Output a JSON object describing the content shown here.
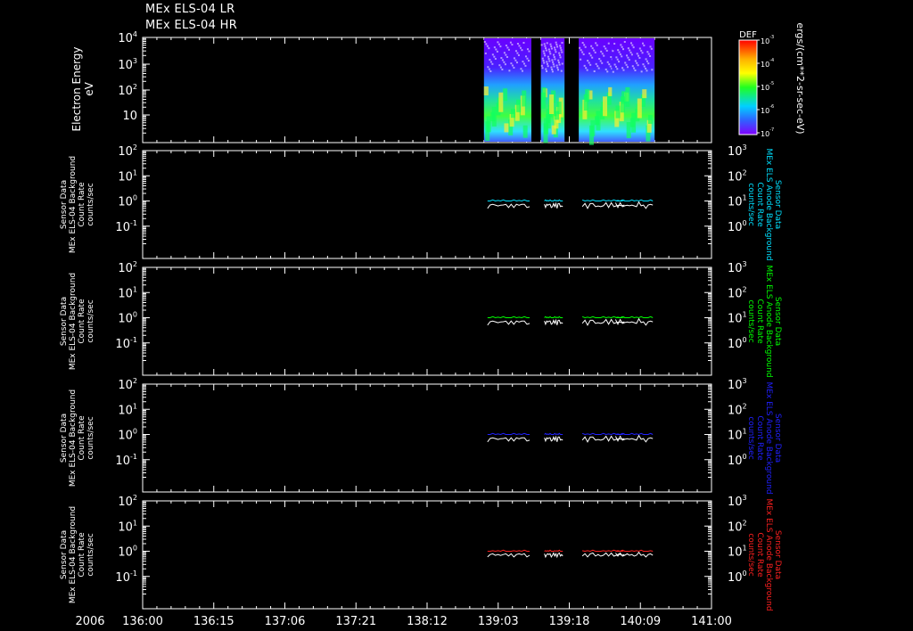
{
  "titles": [
    "MEx ELS-04 LR",
    "MEx ELS-04 HR"
  ],
  "year": "2006",
  "x_ticks": [
    "136:00",
    "136:15",
    "137:06",
    "137:21",
    "138:12",
    "139:03",
    "139:18",
    "140:09",
    "141:00"
  ],
  "colorbar": {
    "title": "DEF",
    "label": "ergs/(cm**2-sr-sec-eV)",
    "tick_labels": [
      {
        "m": "10",
        "e": "-3"
      },
      {
        "m": "10",
        "e": "-4"
      },
      {
        "m": "10",
        "e": "-5"
      },
      {
        "m": "10",
        "e": "-6"
      },
      {
        "m": "10",
        "e": "-7"
      }
    ]
  },
  "chart_data": [
    {
      "type": "heatmap",
      "ylabel": [
        "Electron Energy",
        "eV"
      ],
      "y_scale": "log",
      "y_ticks": [
        {
          "m": "10",
          "e": "4"
        },
        {
          "m": "10",
          "e": "3"
        },
        {
          "m": "10",
          "e": "2"
        },
        {
          "m": "10",
          "e": ""
        }
      ],
      "data_intervals": [
        [
          "139:00",
          "139:10"
        ],
        [
          "139:12",
          "139:17"
        ],
        [
          "139:20",
          "139:30"
        ],
        [
          "140:03",
          "140:12"
        ]
      ],
      "colors": {
        "low": "#5f00ff",
        "high": "#ff0000"
      }
    },
    {
      "type": "line",
      "ylabel_left": [
        "Sensor Data",
        "MEx ELS-04 Background",
        "Count Rate",
        "counts/sec"
      ],
      "ylabel_right": [
        "Sensor Data",
        "MEx ELS Anode Background",
        "Count Rate",
        "counts/sec"
      ],
      "right_color": "#00e0ff",
      "y_scale": "log",
      "left_ticks": [
        {
          "m": "10",
          "e": "2"
        },
        {
          "m": "10",
          "e": "1"
        },
        {
          "m": "10",
          "e": "0"
        },
        {
          "m": "10",
          "e": "-1"
        }
      ],
      "right_ticks": [
        {
          "m": "10",
          "e": "3"
        },
        {
          "m": "10",
          "e": "2"
        },
        {
          "m": "10",
          "e": "1"
        },
        {
          "m": "10",
          "e": "0"
        }
      ],
      "series": [
        {
          "color": "#ffffff",
          "values": [
            0.6,
            0.7,
            0.65,
            0.75,
            0.6,
            0.8,
            0.7,
            0.65
          ]
        },
        {
          "color": "#00e0ff",
          "values": [
            1.0,
            1.0,
            1.1,
            1.0,
            1.05,
            1.0,
            1.1,
            1.0
          ]
        }
      ]
    },
    {
      "type": "line",
      "ylabel_left": [
        "Sensor Data",
        "MEx ELS-04 Background",
        "Count Rate",
        "counts/sec"
      ],
      "ylabel_right": [
        "Sensor Data",
        "MEx ELS Anode Background",
        "Count Rate",
        "counts/sec"
      ],
      "right_color": "#00ff00",
      "y_scale": "log",
      "left_ticks": [
        {
          "m": "10",
          "e": "2"
        },
        {
          "m": "10",
          "e": "1"
        },
        {
          "m": "10",
          "e": "0"
        },
        {
          "m": "10",
          "e": "-1"
        }
      ],
      "right_ticks": [
        {
          "m": "10",
          "e": "3"
        },
        {
          "m": "10",
          "e": "2"
        },
        {
          "m": "10",
          "e": "1"
        },
        {
          "m": "10",
          "e": "0"
        }
      ],
      "series": [
        {
          "color": "#ffffff",
          "values": [
            0.6,
            0.7,
            0.65,
            0.75,
            0.6,
            0.8,
            0.7,
            0.65
          ]
        },
        {
          "color": "#00ff00",
          "values": [
            1.0,
            1.0,
            1.1,
            1.0,
            1.05,
            1.0,
            1.1,
            1.0
          ]
        }
      ]
    },
    {
      "type": "line",
      "ylabel_left": [
        "Sensor Data",
        "MEx ELS-04 Background",
        "Count Rate",
        "counts/sec"
      ],
      "ylabel_right": [
        "Sensor Data",
        "MEx ELS Anode Background",
        "Count Rate",
        "counts/sec"
      ],
      "right_color": "#2020ff",
      "y_scale": "log",
      "left_ticks": [
        {
          "m": "10",
          "e": "2"
        },
        {
          "m": "10",
          "e": "1"
        },
        {
          "m": "10",
          "e": "0"
        },
        {
          "m": "10",
          "e": "-1"
        }
      ],
      "right_ticks": [
        {
          "m": "10",
          "e": "3"
        },
        {
          "m": "10",
          "e": "2"
        },
        {
          "m": "10",
          "e": "1"
        },
        {
          "m": "10",
          "e": "0"
        }
      ],
      "series": [
        {
          "color": "#ffffff",
          "values": [
            0.6,
            0.7,
            0.65,
            0.75,
            0.6,
            0.8,
            0.7,
            0.65
          ]
        },
        {
          "color": "#2020ff",
          "values": [
            1.0,
            1.0,
            1.1,
            1.0,
            1.05,
            1.0,
            1.1,
            1.0
          ]
        }
      ]
    },
    {
      "type": "line",
      "ylabel_left": [
        "Sensor Data",
        "MEx ELS-04 Background",
        "Count Rate",
        "counts/sec"
      ],
      "ylabel_right": [
        "Sensor Data",
        "MEx ELS Anode Background",
        "Count Rate",
        "counts/sec"
      ],
      "right_color": "#ff2020",
      "y_scale": "log",
      "left_ticks": [
        {
          "m": "10",
          "e": "2"
        },
        {
          "m": "10",
          "e": "1"
        },
        {
          "m": "10",
          "e": "0"
        },
        {
          "m": "10",
          "e": "-1"
        }
      ],
      "right_ticks": [
        {
          "m": "10",
          "e": "3"
        },
        {
          "m": "10",
          "e": "2"
        },
        {
          "m": "10",
          "e": "1"
        },
        {
          "m": "10",
          "e": "0"
        }
      ],
      "series": [
        {
          "color": "#ffffff",
          "values": [
            0.7,
            0.75,
            0.7,
            0.75,
            0.7,
            0.8,
            0.75,
            0.7
          ]
        },
        {
          "color": "#ff2020",
          "values": [
            1.0,
            1.0,
            1.05,
            1.0,
            1.05,
            1.0,
            1.1,
            1.0
          ]
        }
      ]
    }
  ]
}
